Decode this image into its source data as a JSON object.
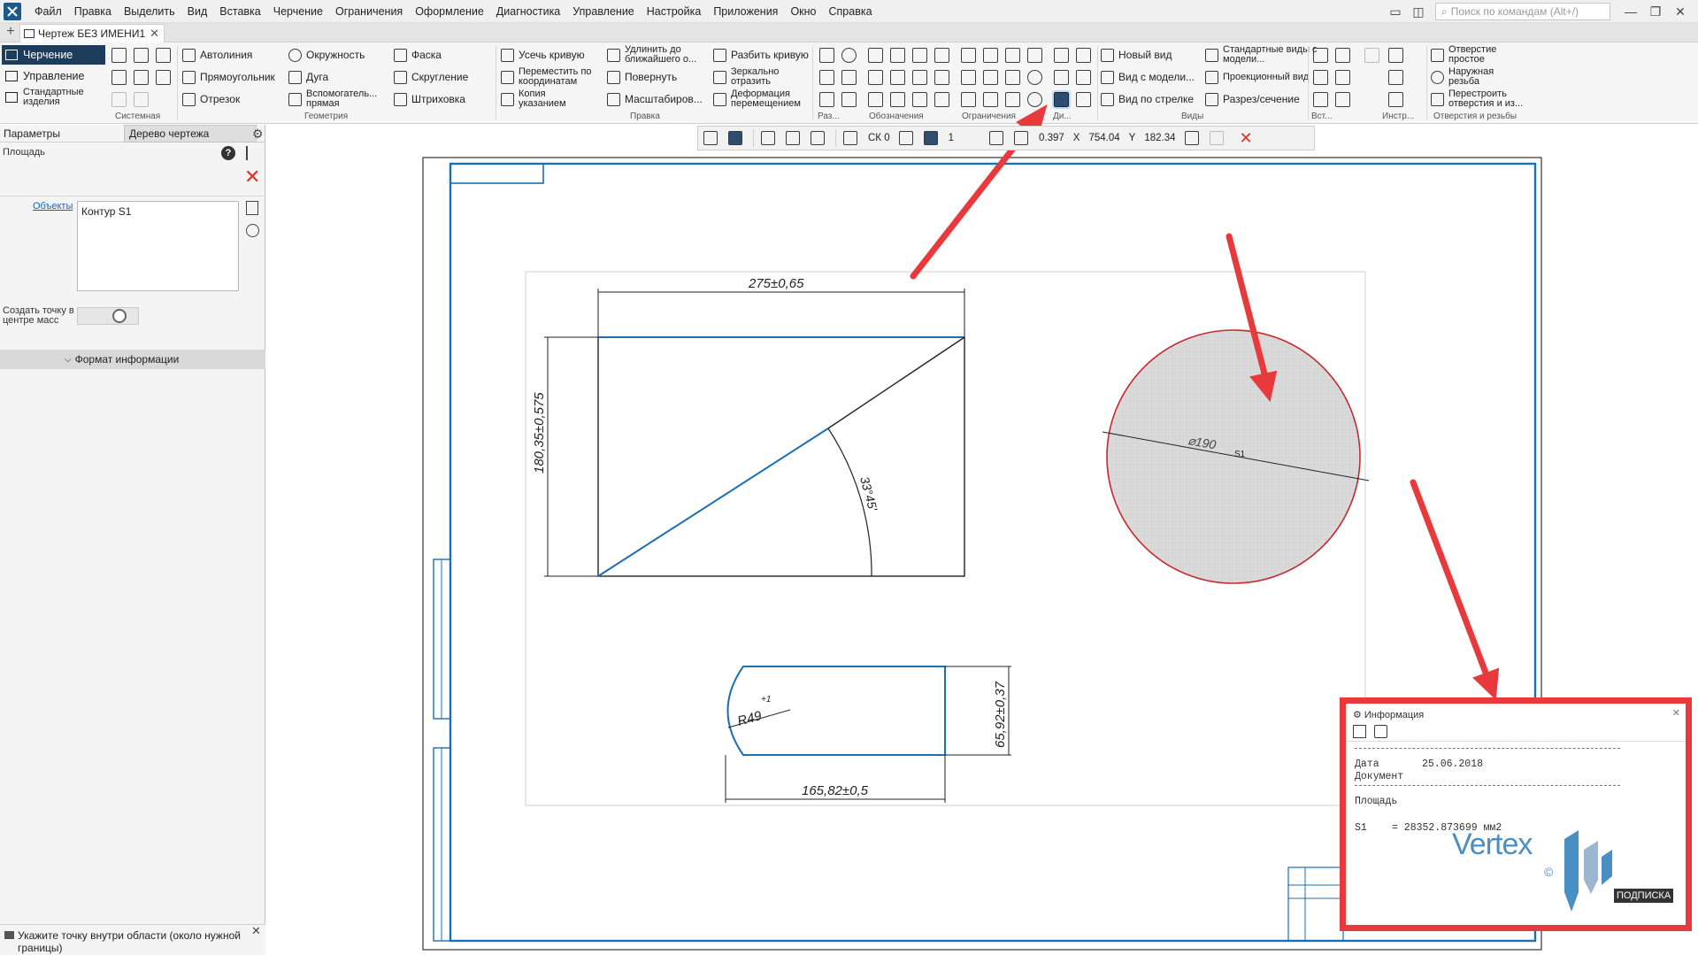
{
  "menu": {
    "items": [
      "Файл",
      "Правка",
      "Выделить",
      "Вид",
      "Вставка",
      "Черчение",
      "Ограничения",
      "Оформление",
      "Диагностика",
      "Управление",
      "Настройка",
      "Приложения",
      "Окно",
      "Справка"
    ],
    "search_placeholder": "Поиск по командам (Alt+/)"
  },
  "tabs": {
    "document_title": "Чертеж БЕЗ ИМЕНИ1"
  },
  "ribbon": {
    "side_tabs": [
      "Черчение",
      "Управление",
      "Стандартные изделия"
    ],
    "groups": {
      "system": "Системная",
      "geometry": "Геометрия",
      "edit": "Правка",
      "dims": "Раз...",
      "designations": "Обозначения",
      "constraints": "Ограничения",
      "diag": "Ди...",
      "views": "Виды",
      "insert": "Вст...",
      "instruments": "Инстр...",
      "holes": "Отверстия и резьбы"
    },
    "geometry_buttons": [
      "Автолиния",
      "Прямоугольник",
      "Отрезок",
      "Окружность",
      "Дуга",
      "Вспомогатель... прямая",
      "Фаска",
      "Скругление",
      "Штриховка"
    ],
    "edit_buttons": [
      "Усечь кривую",
      "Переместить по координатам",
      "Копия указанием",
      "Удлинить до ближайшего о...",
      "Повернуть",
      "Масштабиров...",
      "Разбить кривую",
      "Зеркально отразить",
      "Деформация перемещением"
    ],
    "views_buttons": [
      "Новый вид",
      "Вид с модели...",
      "Вид по стрелке",
      "Стандартные виды с модели...",
      "Проекционный вид",
      "Разрез/сечение"
    ],
    "holes_buttons": [
      "Отверстие простое",
      "Наружная резьба",
      "Перестроить отверстия и из..."
    ]
  },
  "left_panel": {
    "tab_params": "Параметры",
    "tab_tree": "Дерево чертежа",
    "title": "Площадь",
    "objects_link": "Объекты",
    "objects_value": "Контур S1",
    "mass_center_label": "Создать точку в центре масс",
    "format_info": "Формат информации",
    "status_hint": "Укажите точку внутри области (около нужной границы)"
  },
  "snap_toolbar": {
    "cs": "СК 0",
    "step": "1",
    "zoom": "0.397",
    "x_label": "X",
    "x_value": "754.04",
    "y_label": "Y",
    "y_value": "182.34"
  },
  "drawing": {
    "dim_top": "275±0,65",
    "dim_left": "180,35±0,575",
    "dim_angle": "33°45'",
    "dim_bottom_width": "165,82±0,5",
    "dim_bottom_height": "65,92±0,37",
    "dim_radius": "R49",
    "dim_radius_tol": "+1",
    "circle_dim": "⌀190",
    "circle_label": "S1"
  },
  "info_dialog": {
    "title": "Информация",
    "date_label": "Дата",
    "date_value": "25.06.2018",
    "document_label": "Документ",
    "area_label": "Площадь",
    "result_label": "S1",
    "result_value": "= 28352.873699 мм2"
  },
  "watermark": {
    "brand": "Vertex",
    "badge": "ПОДПИСКА"
  },
  "colors": {
    "accent_red": "#e8393d",
    "drawing_blue": "#1b6fb3",
    "ribbon_active": "#1e3d5c",
    "circle_fill": "#d6d6d6"
  }
}
